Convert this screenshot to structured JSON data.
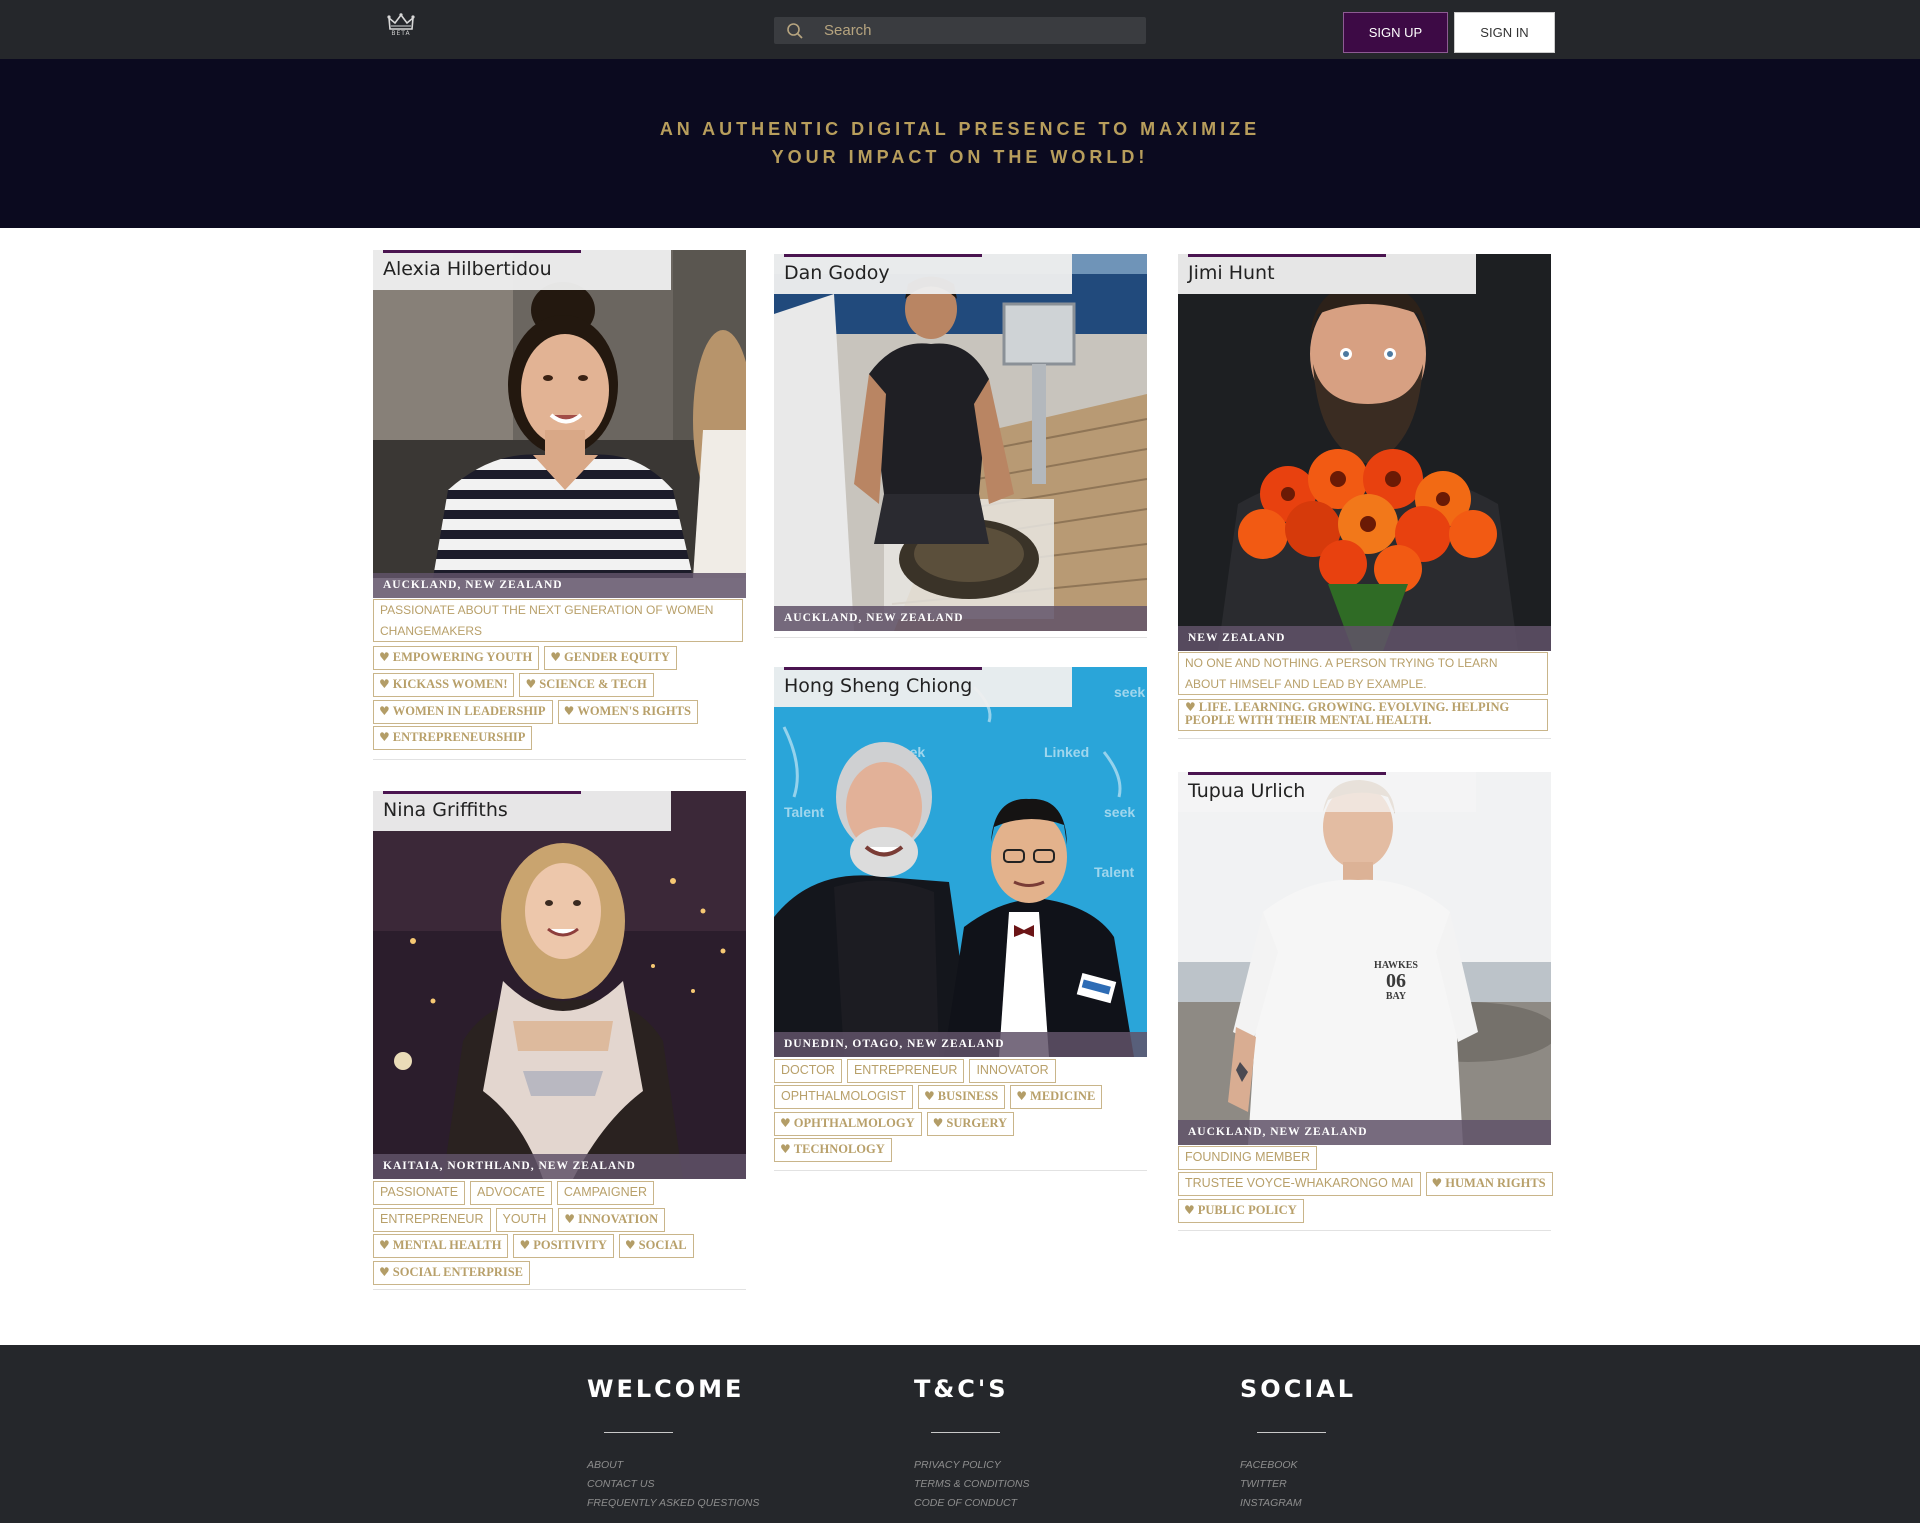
{
  "nav": {
    "logo_text": "BETA",
    "search_placeholder": "Search",
    "signup_label": "SIGN UP",
    "signin_label": "SIGN IN"
  },
  "hero": {
    "line1": "AN AUTHENTIC DIGITAL PRESENCE TO MAXIMIZE",
    "line2": "YOUR IMPACT ON THE WORLD!"
  },
  "cards": {
    "alexia": {
      "name": "Alexia Hilbertidou",
      "location": "AUCKLAND, NEW ZEALAND",
      "bio": "PASSIONATE ABOUT THE NEXT GENERATION OF WOMEN CHANGEMAKERS",
      "tags": [
        "EMPOWERING YOUTH",
        "GENDER EQUITY",
        "KICKASS WOMEN!",
        "SCIENCE & TECH",
        "WOMEN IN LEADERSHIP",
        "WOMEN'S RIGHTS",
        "ENTREPRENEURSHIP"
      ]
    },
    "dan": {
      "name": "Dan Godoy",
      "location": "AUCKLAND, NEW ZEALAND"
    },
    "jimi": {
      "name": "Jimi Hunt",
      "location": "NEW ZEALAND",
      "bio": "NO ONE AND NOTHING. A PERSON TRYING TO LEARN ABOUT HIMSELF AND LEAD BY EXAMPLE.",
      "tags": [
        "LIFE. LEARNING. GROWING. EVOLVING. HELPING PEOPLE WITH THEIR MENTAL HEALTH."
      ]
    },
    "nina": {
      "name": "Nina Griffiths",
      "location": "KAITAIA, NORTHLAND, NEW ZEALAND",
      "tags": [
        "PASSIONATE",
        "ADVOCATE",
        "CAMPAIGNER",
        "ENTREPRENEUR",
        "YOUTH",
        "INNOVATION",
        "MENTAL HEALTH",
        "POSITIVITY",
        "SOCIAL",
        "SOCIAL ENTERPRISE"
      ]
    },
    "hong": {
      "name": "Hong Sheng Chiong",
      "location": "DUNEDIN, OTAGO, NEW ZEALAND",
      "tags": [
        "DOCTOR",
        "ENTREPRENEUR",
        "INNOVATOR",
        "OPHTHALMOLOGIST",
        "BUSINESS",
        "MEDICINE",
        "OPHTHALMOLOGY",
        "SURGERY",
        "TECHNOLOGY"
      ]
    },
    "tupua": {
      "name": "Tupua Urlich",
      "location": "AUCKLAND, NEW ZEALAND",
      "shirt_text": [
        "HAWKES",
        "06",
        "BAY"
      ],
      "tags": [
        "FOUNDING MEMBER",
        "TRUSTEE VOYCE-WHAKARONGO MAI",
        "HUMAN RIGHTS",
        "PUBLIC POLICY"
      ]
    }
  },
  "footer": {
    "welcome": {
      "heading": "WELCOME",
      "links": [
        "ABOUT",
        "CONTACT US",
        "FREQUENTLY ASKED QUESTIONS"
      ]
    },
    "terms": {
      "heading": "T&C'S",
      "links": [
        "PRIVACY POLICY",
        "TERMS & CONDITIONS",
        "CODE OF CONDUCT"
      ]
    },
    "social": {
      "heading": "SOCIAL",
      "links": [
        "FACEBOOK",
        "TWITTER",
        "INSTAGRAM"
      ]
    }
  },
  "colors": {
    "nav_bg": "#25272b",
    "hero_bg": "#0b0a1f",
    "accent_gold": "#b89e5c",
    "brand_purple": "#3d0a45"
  }
}
